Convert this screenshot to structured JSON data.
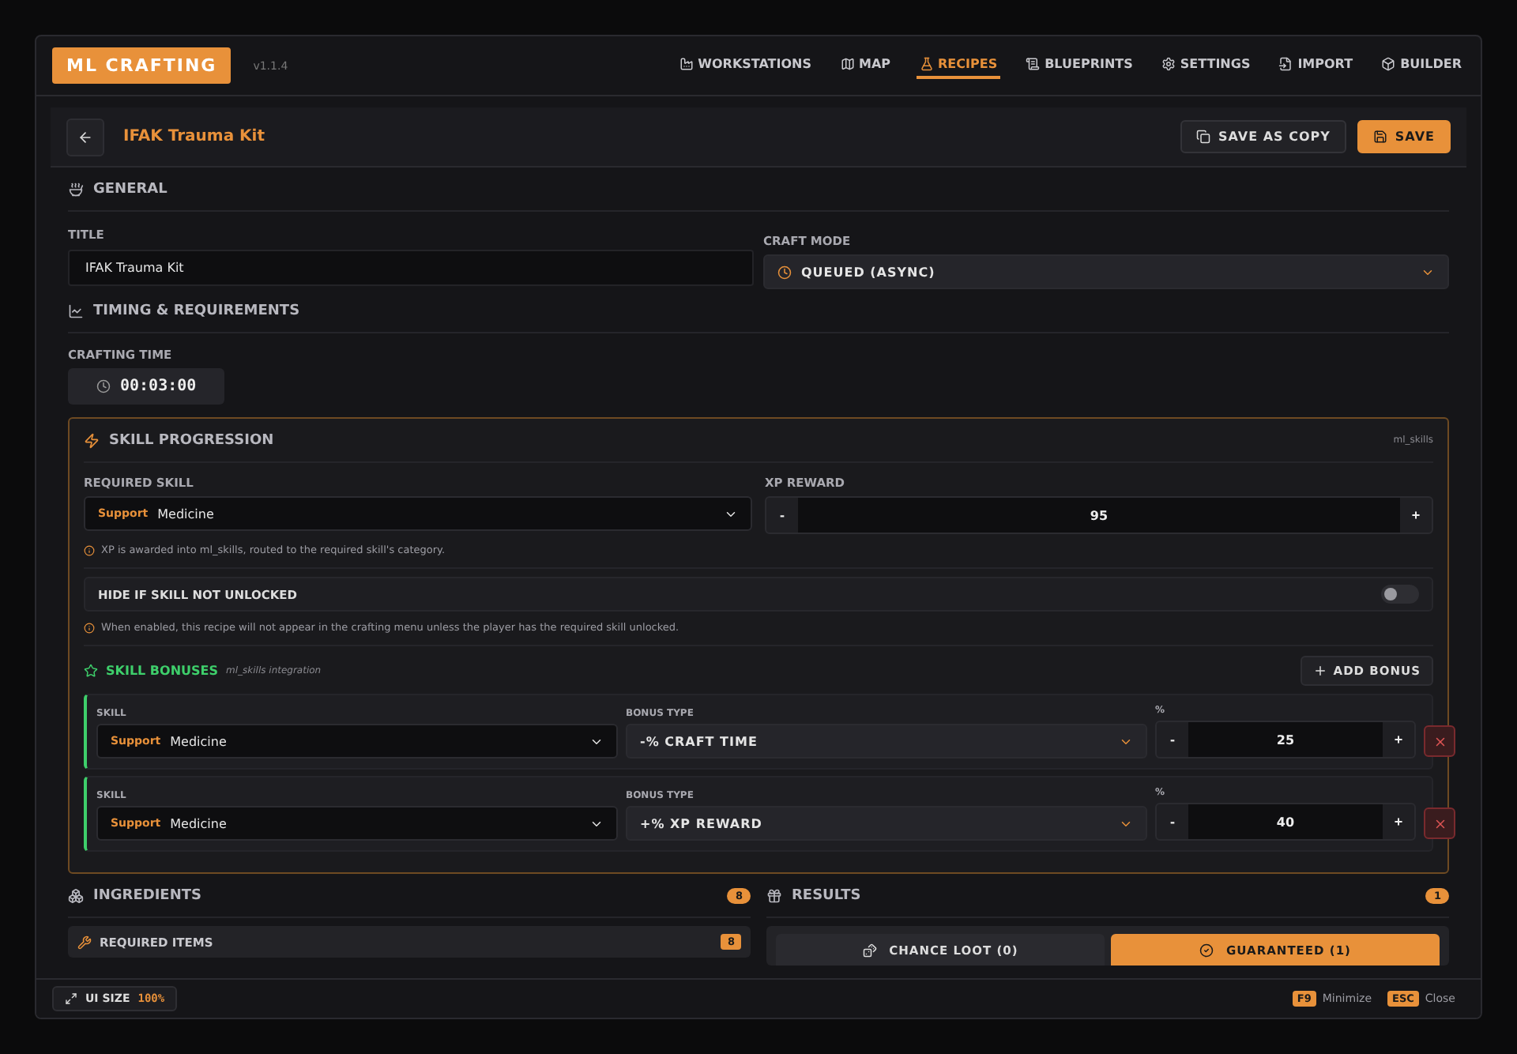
{
  "app": {
    "logo": "ML CRAFTING",
    "version": "v1.1.4"
  },
  "nav": [
    {
      "label": "WORKSTATIONS",
      "selected": false
    },
    {
      "label": "MAP",
      "selected": false
    },
    {
      "label": "RECIPES",
      "selected": true
    },
    {
      "label": "BLUEPRINTS",
      "selected": false
    },
    {
      "label": "SETTINGS",
      "selected": false
    },
    {
      "label": "IMPORT",
      "selected": false
    },
    {
      "label": "BUILDER",
      "selected": false
    }
  ],
  "editor": {
    "title": "IFAK Trauma Kit",
    "buttons": [
      {
        "label": "SAVE AS COPY",
        "kind": "secondary"
      },
      {
        "label": "SAVE",
        "kind": "primary"
      }
    ]
  },
  "general": {
    "heading": "GENERAL",
    "title_field": {
      "label": "TITLE",
      "value": "IFAK Trauma Kit"
    },
    "craft_mode": {
      "label": "CRAFT MODE",
      "value": "QUEUED (ASYNC)"
    }
  },
  "timing": {
    "heading": "TIMING & REQUIREMENTS",
    "crafting_time": {
      "label": "CRAFTING TIME",
      "value": "00:03:00"
    }
  },
  "skill_progression": {
    "heading": "SKILL PROGRESSION",
    "tag": "ml_skills",
    "required_skill": {
      "label": "REQUIRED SKILL",
      "category": "Support",
      "value": "Medicine"
    },
    "xp_reward": {
      "label": "XP REWARD",
      "minus": "-",
      "value": "95",
      "plus": "+"
    },
    "xp_note": "XP is awarded into ml_skills, routed to the required skill's category.",
    "hide_toggle": {
      "label": "HIDE IF SKILL NOT UNLOCKED",
      "on": false
    },
    "hide_note": "When enabled, this recipe will not appear in the crafting menu unless the player has the required skill unlocked.",
    "bonuses": {
      "heading": "SKILL BONUSES",
      "subtitle": "ml_skills integration",
      "add_button": "ADD BONUS",
      "rows": [
        {
          "skill_label": "SKILL",
          "category": "Support",
          "skill": "Medicine",
          "type_label": "BONUS TYPE",
          "type": "-% CRAFT TIME",
          "unit": "%",
          "minus": "-",
          "value": "25",
          "plus": "+"
        },
        {
          "skill_label": "SKILL",
          "category": "Support",
          "skill": "Medicine",
          "type_label": "BONUS TYPE",
          "type": "+% XP REWARD",
          "unit": "%",
          "minus": "-",
          "value": "40",
          "plus": "+"
        }
      ]
    }
  },
  "ingredients": {
    "heading": "INGREDIENTS",
    "count": "8",
    "required_items": {
      "label": "REQUIRED ITEMS",
      "count": "8"
    }
  },
  "results": {
    "heading": "RESULTS",
    "count": "1",
    "tabs": [
      {
        "label": "CHANCE LOOT (0)",
        "selected": false
      },
      {
        "label": "GUARANTEED (1)",
        "selected": true
      }
    ]
  },
  "footer": {
    "ui_size": {
      "label": "UI SIZE",
      "value": "100%"
    },
    "shortcuts": [
      {
        "key": "F9",
        "label": "Minimize"
      },
      {
        "key": "ESC",
        "label": "Close"
      }
    ]
  }
}
